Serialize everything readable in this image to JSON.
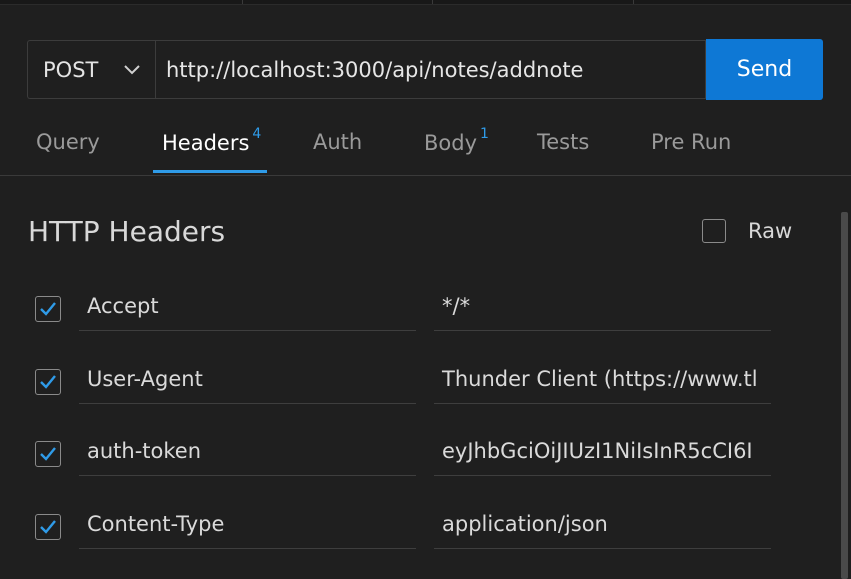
{
  "request": {
    "method": "POST",
    "url": "http://localhost:3000/api/notes/addnote",
    "send_label": "Send"
  },
  "tabs": [
    {
      "label": "Query",
      "badge": ""
    },
    {
      "label": "Headers",
      "badge": "4"
    },
    {
      "label": "Auth",
      "badge": ""
    },
    {
      "label": "Body",
      "badge": "1"
    },
    {
      "label": "Tests",
      "badge": ""
    },
    {
      "label": "Pre Run",
      "badge": ""
    }
  ],
  "headers_section": {
    "title": "HTTP Headers",
    "raw_label": "Raw",
    "rows": [
      {
        "key": "Accept",
        "value": "*/*",
        "checked": true
      },
      {
        "key": "User-Agent",
        "value": "Thunder Client (https://www.tl",
        "checked": true
      },
      {
        "key": "auth-token",
        "value": "eyJhbGciOiJIUzI1NiIsInR5cCI6I",
        "checked": true
      },
      {
        "key": "Content-Type",
        "value": "application/json",
        "checked": true
      }
    ]
  },
  "colors": {
    "accent": "#2f9be8",
    "send_button": "#0e78d5",
    "background": "#1f1f1f"
  },
  "icons": {
    "method_dropdown": "chevron-down-icon",
    "checked": "checkmark-icon"
  }
}
